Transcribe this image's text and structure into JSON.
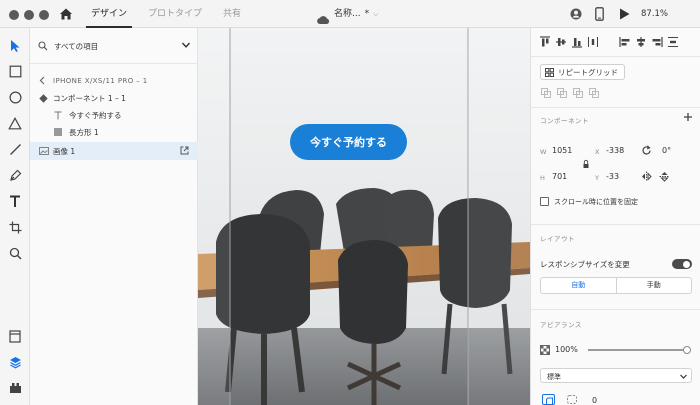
{
  "titlebar": {
    "tabs": [
      {
        "label": "デザイン",
        "active": true
      },
      {
        "label": "プロトタイプ",
        "active": false
      },
      {
        "label": "共有",
        "active": false
      }
    ],
    "document_title": "名称...",
    "modified_marker": "*",
    "zoom": "87.1%"
  },
  "layers": {
    "filter_label": "すべての項目",
    "breadcrumb": "IPHONE X/XS/11 PRO – 1",
    "items": [
      {
        "label": "コンポーネント 1 – 1",
        "icon": "component-diamond-icon",
        "indent": 0
      },
      {
        "label": "今すぐ予約する",
        "icon": "text-layer-icon",
        "indent": 1
      },
      {
        "label": "長方形 1",
        "icon": "rectangle-layer-icon",
        "indent": 1
      },
      {
        "label": "画像 1",
        "icon": "image-layer-icon",
        "indent": 0,
        "selected": true
      }
    ]
  },
  "canvas": {
    "button_label": "今すぐ予約する",
    "accent_color": "#1a7fd6"
  },
  "inspector": {
    "repeat_grid_label": "リピートグリッド",
    "component_title": "コンポーネント",
    "w_label": "W",
    "w_value": "1051",
    "x_label": "X",
    "x_value": "-338",
    "rotation_value": "0°",
    "h_label": "H",
    "h_value": "701",
    "y_label": "Y",
    "y_value": "-33",
    "fix_position_label": "スクロール時に位置を固定",
    "layout_title": "レイアウト",
    "responsive_label": "レスポンシブサイズを変更",
    "responsive_on": true,
    "seg_auto": "自動",
    "seg_manual": "手動",
    "appearance_title": "アピアランス",
    "opacity_value": "100%",
    "blend_mode": "標準",
    "corner_value": "0"
  }
}
